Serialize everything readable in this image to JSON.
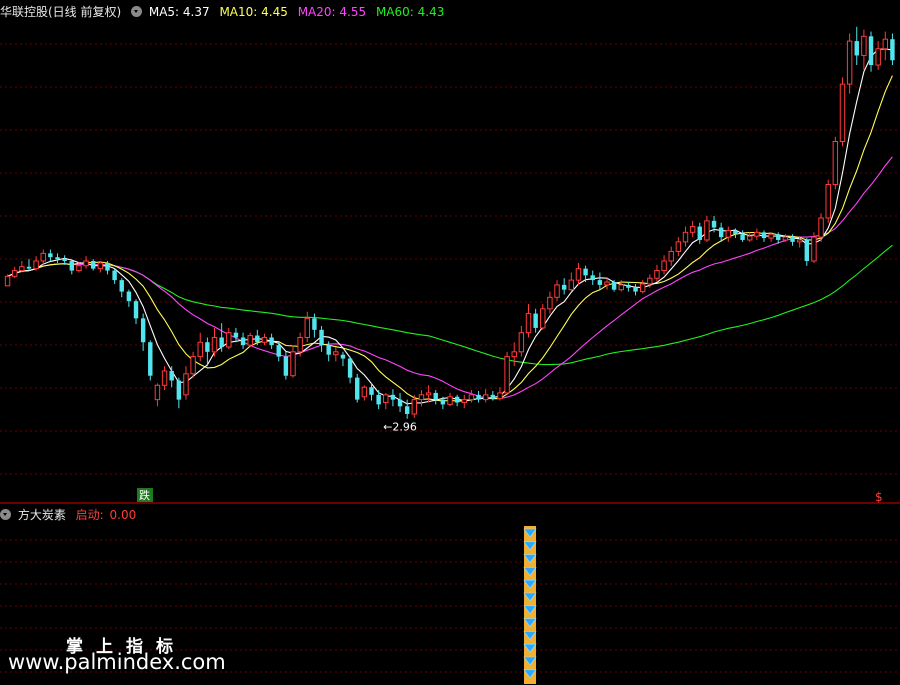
{
  "header": {
    "stock_name": "华联控股(日线 前复权)",
    "ma5": "MA5: 4.37",
    "ma10": "MA10: 4.45",
    "ma20": "MA20: 4.55",
    "ma60": "MA60: 4.43"
  },
  "indicator": {
    "name": "方大炭素",
    "label": "启动:",
    "value": "0.00"
  },
  "watermark": {
    "title": "掌上指标",
    "url": "www.palmindex.com"
  },
  "colors": {
    "background": "#000000",
    "up": "#ff3b3b",
    "down": "#52e5ee",
    "ma5": "#ffffff",
    "ma10": "#ffff55",
    "ma20": "#ff44ff",
    "ma60": "#22ee22",
    "grid": "#8a0000",
    "signal_column": "#f0b030",
    "signal_diamond": "#2aa8ff"
  },
  "chart_data": {
    "type": "candlestick",
    "timeframe": "daily",
    "price_scale": [
      2.0,
      7.0
    ],
    "annotations": {
      "low_label": "←2.96",
      "fall_marker": "跌",
      "buy_marker": "$"
    },
    "candles": [
      [
        4.24,
        4.34,
        4.24,
        4.36
      ],
      [
        4.34,
        4.4,
        4.32,
        4.44
      ],
      [
        4.4,
        4.44,
        4.38,
        4.5
      ],
      [
        4.44,
        4.42,
        4.4,
        4.52
      ],
      [
        4.42,
        4.5,
        4.4,
        4.55
      ],
      [
        4.5,
        4.58,
        4.45,
        4.62
      ],
      [
        4.58,
        4.54,
        4.5,
        4.62
      ],
      [
        4.54,
        4.52,
        4.48,
        4.58
      ],
      [
        4.52,
        4.5,
        4.46,
        4.56
      ],
      [
        4.5,
        4.4,
        4.36,
        4.52
      ],
      [
        4.4,
        4.45,
        4.38,
        4.49
      ],
      [
        4.45,
        4.5,
        4.42,
        4.55
      ],
      [
        4.5,
        4.42,
        4.4,
        4.52
      ],
      [
        4.42,
        4.48,
        4.38,
        4.5
      ],
      [
        4.48,
        4.4,
        4.36,
        4.5
      ],
      [
        4.4,
        4.3,
        4.26,
        4.42
      ],
      [
        4.3,
        4.18,
        4.12,
        4.32
      ],
      [
        4.18,
        4.08,
        4.02,
        4.2
      ],
      [
        4.08,
        3.9,
        3.84,
        4.1
      ],
      [
        3.9,
        3.65,
        3.56,
        3.95
      ],
      [
        3.65,
        3.3,
        3.25,
        3.67
      ],
      [
        3.05,
        3.2,
        2.98,
        3.22
      ],
      [
        3.2,
        3.35,
        3.15,
        3.4
      ],
      [
        3.35,
        3.25,
        3.18,
        3.4
      ],
      [
        3.25,
        3.05,
        2.96,
        3.28
      ],
      [
        3.1,
        3.32,
        3.05,
        3.4
      ],
      [
        3.32,
        3.5,
        3.28,
        3.55
      ],
      [
        3.5,
        3.65,
        3.45,
        3.75
      ],
      [
        3.65,
        3.55,
        3.4,
        3.7
      ],
      [
        3.55,
        3.7,
        3.5,
        3.8
      ],
      [
        3.7,
        3.6,
        3.55,
        3.85
      ],
      [
        3.6,
        3.75,
        3.58,
        3.8
      ],
      [
        3.75,
        3.7,
        3.65,
        3.8
      ],
      [
        3.7,
        3.62,
        3.58,
        3.75
      ],
      [
        3.62,
        3.72,
        3.6,
        3.75
      ],
      [
        3.72,
        3.65,
        3.62,
        3.78
      ],
      [
        3.65,
        3.7,
        3.62,
        3.74
      ],
      [
        3.7,
        3.62,
        3.58,
        3.74
      ],
      [
        3.62,
        3.5,
        3.45,
        3.65
      ],
      [
        3.5,
        3.3,
        3.26,
        3.55
      ],
      [
        3.3,
        3.55,
        3.28,
        3.62
      ],
      [
        3.55,
        3.7,
        3.5,
        3.75
      ],
      [
        3.7,
        3.9,
        3.65,
        3.97
      ],
      [
        3.9,
        3.78,
        3.7,
        3.95
      ],
      [
        3.78,
        3.62,
        3.55,
        3.82
      ],
      [
        3.62,
        3.52,
        3.45,
        3.66
      ],
      [
        3.52,
        3.55,
        3.45,
        3.6
      ],
      [
        3.52,
        3.48,
        3.4,
        3.55
      ],
      [
        3.48,
        3.28,
        3.22,
        3.5
      ],
      [
        3.28,
        3.05,
        3.02,
        3.32
      ],
      [
        3.08,
        3.18,
        3.04,
        3.2
      ],
      [
        3.18,
        3.1,
        3.04,
        3.22
      ],
      [
        3.1,
        3.0,
        2.95,
        3.15
      ],
      [
        3.02,
        3.1,
        2.95,
        3.12
      ],
      [
        3.1,
        3.05,
        2.98,
        3.16
      ],
      [
        3.05,
        2.98,
        2.92,
        3.12
      ],
      [
        2.98,
        2.9,
        2.85,
        3.05
      ],
      [
        2.9,
        3.05,
        2.86,
        3.1
      ],
      [
        3.05,
        3.1,
        2.98,
        3.15
      ],
      [
        3.1,
        3.12,
        3.02,
        3.2
      ],
      [
        3.12,
        3.05,
        3.0,
        3.15
      ],
      [
        3.05,
        3.0,
        2.95,
        3.08
      ],
      [
        3.0,
        3.08,
        2.98,
        3.12
      ],
      [
        3.08,
        3.02,
        2.98,
        3.1
      ],
      [
        3.02,
        3.05,
        2.96,
        3.1
      ],
      [
        3.05,
        3.1,
        3.02,
        3.15
      ],
      [
        3.1,
        3.05,
        3.02,
        3.14
      ],
      [
        3.05,
        3.1,
        3.02,
        3.16
      ],
      [
        3.1,
        3.06,
        3.04,
        3.14
      ],
      [
        3.06,
        3.12,
        3.04,
        3.18
      ],
      [
        3.12,
        3.5,
        3.1,
        3.55
      ],
      [
        3.5,
        3.55,
        3.4,
        3.65
      ],
      [
        3.55,
        3.75,
        3.5,
        3.82
      ],
      [
        3.75,
        3.95,
        3.7,
        4.05
      ],
      [
        3.95,
        3.8,
        3.75,
        4.0
      ],
      [
        3.8,
        4.0,
        3.78,
        4.05
      ],
      [
        4.0,
        4.12,
        3.95,
        4.18
      ],
      [
        4.12,
        4.25,
        4.08,
        4.3
      ],
      [
        4.25,
        4.2,
        4.15,
        4.32
      ],
      [
        4.2,
        4.3,
        4.18,
        4.38
      ],
      [
        4.3,
        4.42,
        4.25,
        4.48
      ],
      [
        4.42,
        4.35,
        4.28,
        4.45
      ],
      [
        4.35,
        4.3,
        4.25,
        4.4
      ],
      [
        4.3,
        4.25,
        4.2,
        4.38
      ],
      [
        4.25,
        4.28,
        4.2,
        4.32
      ],
      [
        4.28,
        4.2,
        4.18,
        4.3
      ],
      [
        4.2,
        4.25,
        4.18,
        4.3
      ],
      [
        4.25,
        4.22,
        4.18,
        4.28
      ],
      [
        4.22,
        4.18,
        4.14,
        4.26
      ],
      [
        4.18,
        4.26,
        4.16,
        4.3
      ],
      [
        4.26,
        4.32,
        4.22,
        4.36
      ],
      [
        4.32,
        4.4,
        4.28,
        4.46
      ],
      [
        4.4,
        4.5,
        4.36,
        4.56
      ],
      [
        4.5,
        4.6,
        4.45,
        4.65
      ],
      [
        4.6,
        4.7,
        4.55,
        4.75
      ],
      [
        4.7,
        4.8,
        4.65,
        4.86
      ],
      [
        4.8,
        4.86,
        4.75,
        4.92
      ],
      [
        4.86,
        4.72,
        4.68,
        4.9
      ],
      [
        4.72,
        4.92,
        4.7,
        4.97
      ],
      [
        4.92,
        4.85,
        4.8,
        4.97
      ],
      [
        4.85,
        4.75,
        4.7,
        4.9
      ],
      [
        4.75,
        4.82,
        4.7,
        4.86
      ],
      [
        4.82,
        4.78,
        4.74,
        4.84
      ],
      [
        4.78,
        4.72,
        4.7,
        4.82
      ],
      [
        4.72,
        4.76,
        4.7,
        4.8
      ],
      [
        4.76,
        4.8,
        4.72,
        4.84
      ],
      [
        4.8,
        4.74,
        4.7,
        4.82
      ],
      [
        4.74,
        4.78,
        4.7,
        4.8
      ],
      [
        4.78,
        4.72,
        4.68,
        4.8
      ],
      [
        4.72,
        4.75,
        4.7,
        4.78
      ],
      [
        4.75,
        4.7,
        4.66,
        4.78
      ],
      [
        4.7,
        4.72,
        4.64,
        4.76
      ],
      [
        4.72,
        4.5,
        4.45,
        4.74
      ],
      [
        4.5,
        4.75,
        4.48,
        4.8
      ],
      [
        4.75,
        4.95,
        4.7,
        5.0
      ],
      [
        4.95,
        5.3,
        4.9,
        5.35
      ],
      [
        5.3,
        5.75,
        5.25,
        5.8
      ],
      [
        5.75,
        6.35,
        5.7,
        6.42
      ],
      [
        6.35,
        6.8,
        6.25,
        6.88
      ],
      [
        6.8,
        6.65,
        6.55,
        6.95
      ],
      [
        6.65,
        6.85,
        6.5,
        6.92
      ],
      [
        6.85,
        6.55,
        6.48,
        6.9
      ],
      [
        6.55,
        6.72,
        6.5,
        6.8
      ],
      [
        6.72,
        6.82,
        6.6,
        6.9
      ],
      [
        6.82,
        6.6,
        6.55,
        6.88
      ]
    ],
    "indicator_panel": {
      "series_name": "启动",
      "value": 0.0,
      "signal_bar_index": 81
    }
  }
}
